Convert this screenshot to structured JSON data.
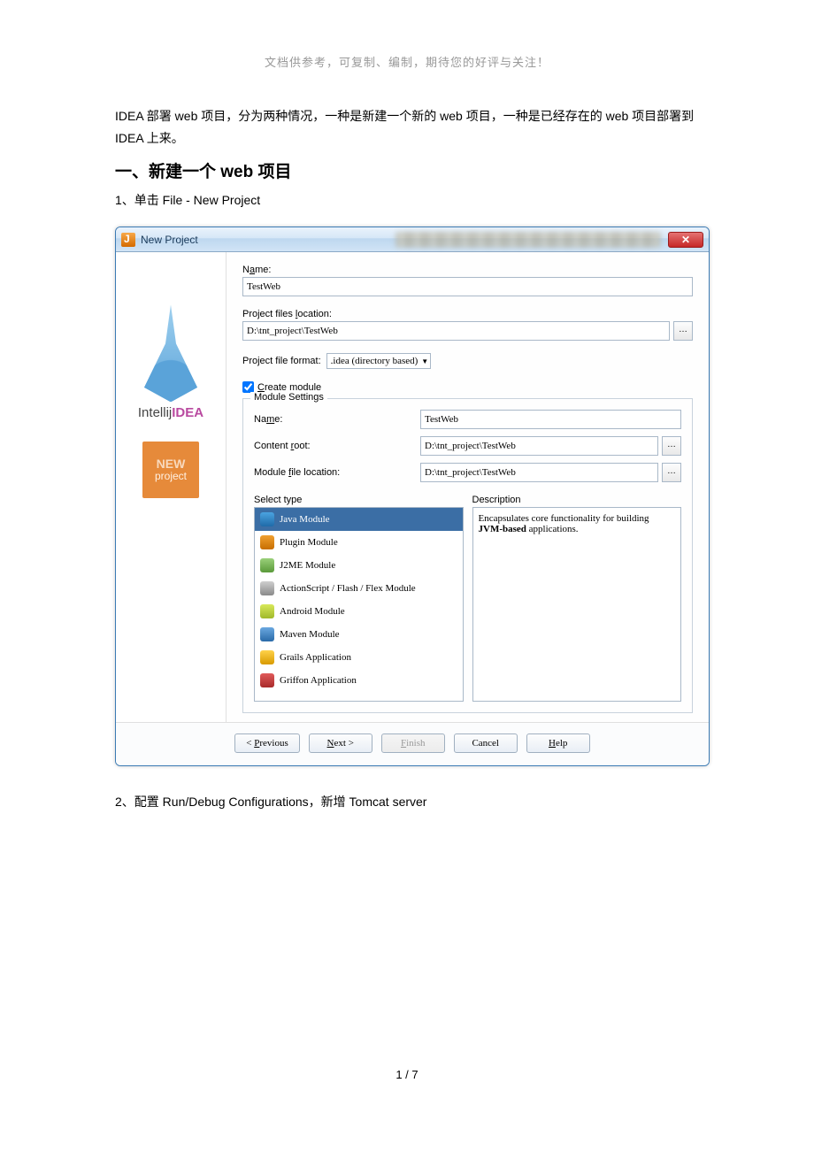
{
  "doc": {
    "header_note": "文档供参考，可复制、编制，期待您的好评与关注！",
    "intro": "IDEA 部署 web 项目，分为两种情况，一种是新建一个新的 web 项目，一种是已经存在的 web 项目部署到 IDEA 上来。",
    "heading1": "一、新建一个 web 项目",
    "step1": "1、单击 File - New Project",
    "step2": "2、配置 Run/Debug Configurations，新增 Tomcat server",
    "pager": "1  /  7"
  },
  "dialog": {
    "window_title": "New Project",
    "close_x": "✕",
    "sidebar": {
      "logo_text_prefix": "Intellij",
      "logo_text_bold": "IDEA",
      "badge_line1": "NEW",
      "badge_line2": "project"
    },
    "labels": {
      "name": "Name:",
      "project_files_location": "Project files location:",
      "project_file_format": "Project file format:",
      "create_module": "Create module",
      "module_settings": "Module Settings",
      "module_name": "Name:",
      "content_root": "Content root:",
      "module_file_location": "Module file location:",
      "select_type": "Select type",
      "description": "Description"
    },
    "values": {
      "name": "TestWeb",
      "project_files_location": "D:\\tnt_project\\TestWeb",
      "file_format": ".idea (directory based)",
      "create_module_checked": true,
      "module_name": "TestWeb",
      "content_root": "D:\\tnt_project\\TestWeb",
      "module_file_location": "D:\\tnt_project\\TestWeb",
      "browse_glyph": "…"
    },
    "types": [
      {
        "id": "java",
        "label": "Java Module",
        "selected": true
      },
      {
        "id": "plugin",
        "label": "Plugin Module",
        "selected": false
      },
      {
        "id": "j2me",
        "label": "J2ME Module",
        "selected": false
      },
      {
        "id": "flex",
        "label": "ActionScript / Flash / Flex Module",
        "selected": false
      },
      {
        "id": "android",
        "label": "Android Module",
        "selected": false
      },
      {
        "id": "maven",
        "label": "Maven Module",
        "selected": false
      },
      {
        "id": "grails",
        "label": "Grails Application",
        "selected": false
      },
      {
        "id": "griffon",
        "label": "Griffon Application",
        "selected": false
      }
    ],
    "description_text_prefix": "Encapsulates core functionality for building ",
    "description_text_bold": "JVM-based",
    "description_text_suffix": " applications.",
    "buttons": {
      "previous": "< Previous",
      "next": "Next >",
      "finish": "Finish",
      "cancel": "Cancel",
      "help": "Help"
    }
  }
}
